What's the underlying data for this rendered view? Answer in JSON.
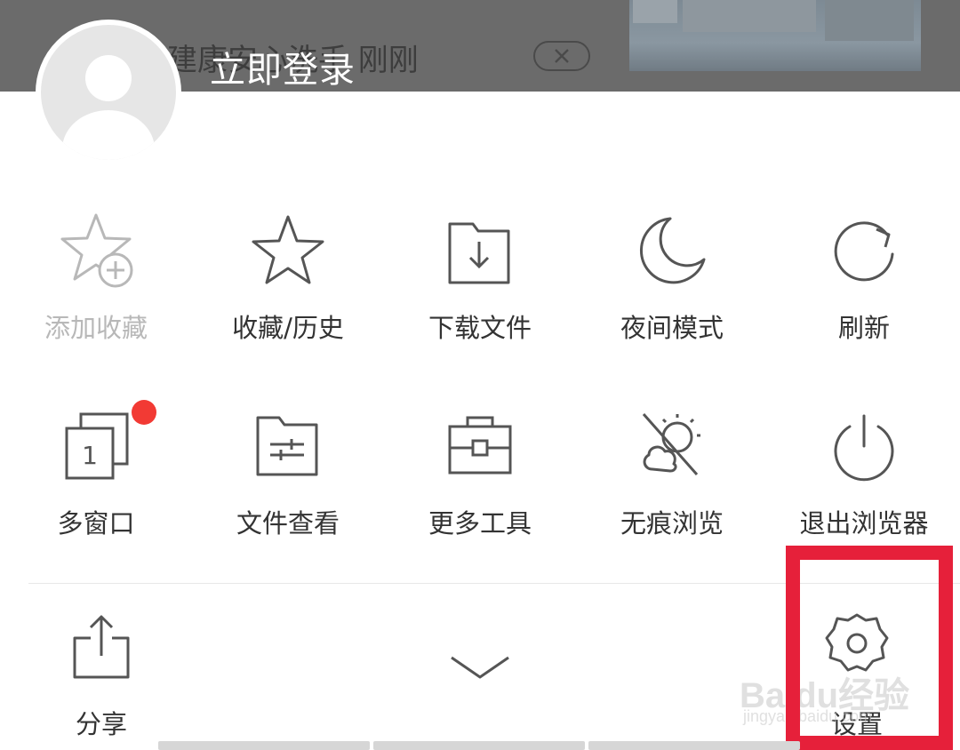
{
  "background": {
    "headline": "建康安心洗手 刚刚",
    "close_icon": "close-icon"
  },
  "header": {
    "login_label": "立即登录",
    "avatar_icon": "default-avatar-icon"
  },
  "menu": {
    "row1": [
      {
        "label": "添加收藏",
        "icon": "star-plus-icon",
        "disabled": true
      },
      {
        "label": "收藏/历史",
        "icon": "star-icon"
      },
      {
        "label": "下载文件",
        "icon": "download-folder-icon"
      },
      {
        "label": "夜间模式",
        "icon": "moon-icon"
      },
      {
        "label": "刷新",
        "icon": "refresh-icon"
      }
    ],
    "row2": [
      {
        "label": "多窗口",
        "icon": "multi-window-icon",
        "window_count": "1",
        "has_badge": true
      },
      {
        "label": "文件查看",
        "icon": "folder-sliders-icon"
      },
      {
        "label": "更多工具",
        "icon": "toolbox-icon"
      },
      {
        "label": "无痕浏览",
        "icon": "incognito-icon"
      },
      {
        "label": "退出浏览器",
        "icon": "power-icon"
      }
    ]
  },
  "bottom": {
    "share_label": "分享",
    "collapse_icon": "chevron-down-icon",
    "settings_label": "设置"
  },
  "watermark": {
    "text": "Baidu经验",
    "sub": "jingyan.baidu.com"
  },
  "colors": {
    "accent_highlight": "#e6203a",
    "badge": "#f23a34",
    "icon_stroke": "#555555",
    "disabled": "#b8b8b8"
  }
}
